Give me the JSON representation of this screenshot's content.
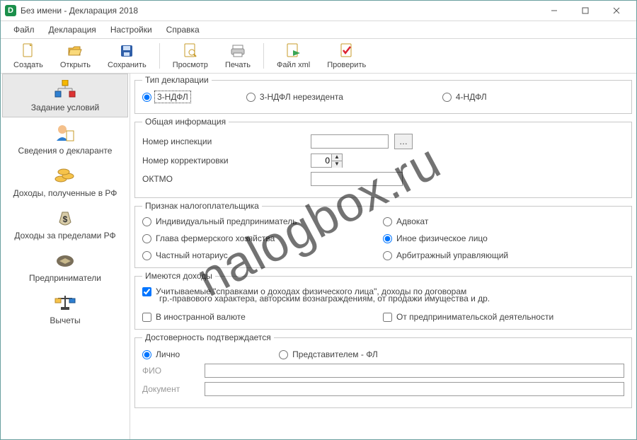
{
  "window": {
    "title": "Без имени - Декларация 2018",
    "app_icon_glyph": "D"
  },
  "menubar": {
    "file": "Файл",
    "declaration": "Декларация",
    "settings": "Настройки",
    "help": "Справка"
  },
  "toolbar": {
    "create": "Создать",
    "open": "Открыть",
    "save": "Сохранить",
    "preview": "Просмотр",
    "print": "Печать",
    "file_xml": "Файл xml",
    "check": "Проверить"
  },
  "sidebar": {
    "items": [
      {
        "label": "Задание условий"
      },
      {
        "label": "Сведения о декларанте"
      },
      {
        "label": "Доходы, полученные в РФ"
      },
      {
        "label": "Доходы за пределами РФ"
      },
      {
        "label": "Предприниматели"
      },
      {
        "label": "Вычеты"
      }
    ]
  },
  "groups": {
    "decl_type": {
      "legend": "Тип декларации",
      "opt1": "3-НДФЛ",
      "opt2": "3-НДФЛ нерезидента",
      "opt3": "4-НДФЛ"
    },
    "general": {
      "legend": "Общая информация",
      "inspection_label": "Номер инспекции",
      "inspection_value": "",
      "correction_label": "Номер корректировки",
      "correction_value": "0",
      "oktmo_label": "ОКТМО",
      "oktmo_value": ""
    },
    "taxpayer": {
      "legend": "Признак налогоплательщика",
      "opt1": "Индивидуальный предприниматель",
      "opt2": "Адвокат",
      "opt3": "Глава фермерского хозяйства",
      "opt4": "Иное физическое лицо",
      "opt5": "Частный нотариус",
      "opt6": "Арбитражный управляющий"
    },
    "income": {
      "legend": "Имеются доходы",
      "opt1": "Учитываемые \"справками о доходах физического лица\", доходы по договорам",
      "opt1_line2": "гр.-правового характера, авторским вознаграждениям, от продажи имущества и др.",
      "opt2": "В иностранной валюте",
      "opt3": "От предпринимательской деятельности"
    },
    "confirm": {
      "legend": "Достоверность подтверждается",
      "opt1": "Лично",
      "opt2": "Представителем - ФЛ",
      "fio_label": "ФИО",
      "fio_value": "",
      "doc_label": "Документ",
      "doc_value": ""
    }
  },
  "watermark": "nalogbox.ru"
}
